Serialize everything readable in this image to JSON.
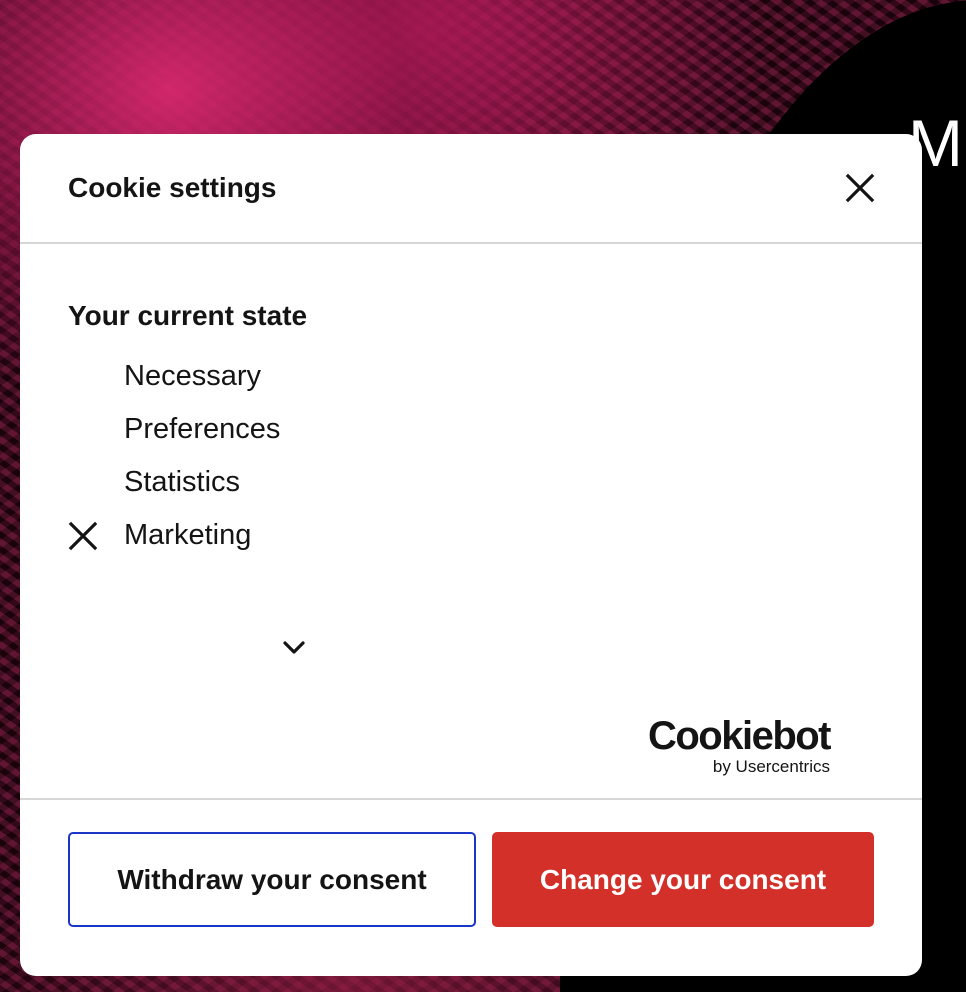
{
  "background": {
    "heading_fragment": "M"
  },
  "dialog": {
    "title": "Cookie settings",
    "close_icon": "close-icon",
    "section_title": "Your current state",
    "states": [
      {
        "label": "Necessary",
        "status": "accepted",
        "icon": ""
      },
      {
        "label": "Preferences",
        "status": "accepted",
        "icon": ""
      },
      {
        "label": "Statistics",
        "status": "accepted",
        "icon": ""
      },
      {
        "label": "Marketing",
        "status": "declined",
        "icon": "x-icon"
      }
    ],
    "expand_icon": "chevron-down-icon",
    "logo": {
      "name": "Cookiebot",
      "tagline": "by Usercentrics"
    },
    "buttons": {
      "withdraw_label": "Withdraw your consent",
      "change_label": "Change your consent"
    }
  },
  "colors": {
    "primary_button": "#d3302a",
    "focus_outline": "#1a36c8",
    "text": "#141414",
    "divider": "#d6d6d6"
  }
}
